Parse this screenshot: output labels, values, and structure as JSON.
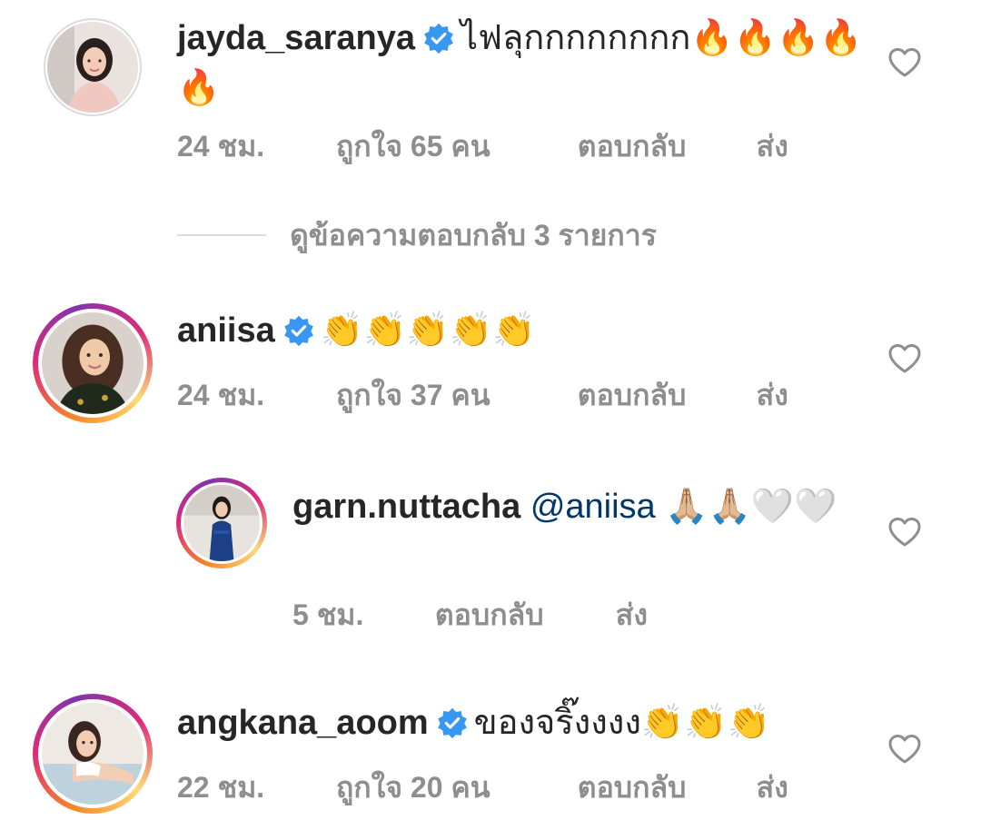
{
  "comments": [
    {
      "username": "jayda_saranya",
      "verified": true,
      "text": "ไฟลุกกกกกกกก🔥🔥🔥🔥🔥",
      "time": "24 ชม.",
      "likes": "ถูกใจ 65 คน",
      "reply": "ตอบกลับ",
      "send": "ส่ง"
    },
    {
      "username": "aniisa",
      "verified": true,
      "text": "👏👏👏👏👏",
      "time": "24 ชม.",
      "likes": "ถูกใจ 37 คน",
      "reply": "ตอบกลับ",
      "send": "ส่ง"
    },
    {
      "username": "garn.nuttacha",
      "verified": false,
      "mention": "@aniisa",
      "text": "🙏🏼🙏🏼🤍🤍",
      "time": "5 ชม.",
      "reply": "ตอบกลับ",
      "send": "ส่ง"
    },
    {
      "username": "angkana_aoom",
      "verified": true,
      "text": "ของจริ๊งงงง👏👏👏",
      "time": "22 ชม.",
      "likes": "ถูกใจ 20 คน",
      "reply": "ตอบกลับ",
      "send": "ส่ง"
    }
  ],
  "view_replies": "ดูข้อความตอบกลับ 3 รายการ",
  "colors": {
    "verified_blue": "#3897f0",
    "meta_gray": "#8e8e8e",
    "mention_blue": "#00376b"
  },
  "icons": {
    "verified": "verified-badge-icon",
    "like": "heart-outline-icon"
  }
}
